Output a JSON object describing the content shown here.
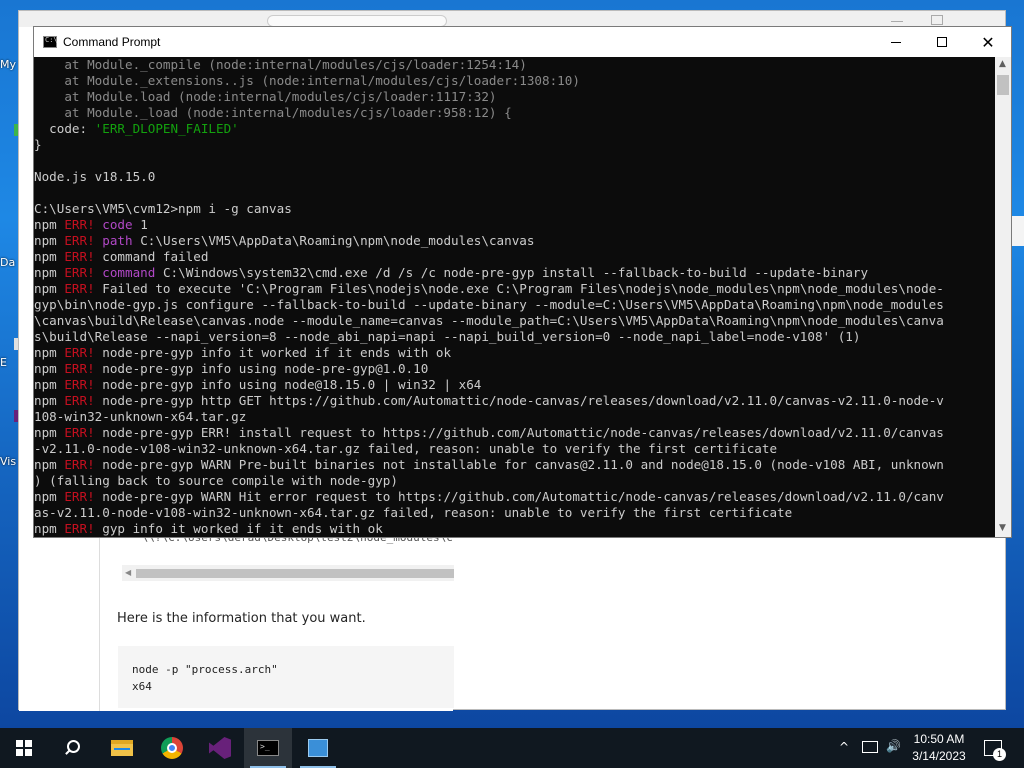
{
  "desktop": {
    "icon_labels": [
      "My",
      "Da",
      "E",
      "Vis"
    ]
  },
  "browser": {
    "path_fragment": "\"\\\\?\\C:\\Users\\derad\\Desktop\\test2\\node_modules\\c",
    "info_text": "Here is the information that you want.",
    "code_lines": [
      "node -p \"process.arch\"",
      "x64"
    ]
  },
  "cmd_window": {
    "title": "Command Prompt",
    "icon": "C:\\",
    "buttons": {
      "minimize": "minimize-icon",
      "maximize": "maximize-icon",
      "close": "close-icon"
    },
    "close_glyph": "✕",
    "lines": [
      [
        {
          "t": "    at Module._compile (node:internal/modules/cjs/loader:1254:14)",
          "c": "gray"
        }
      ],
      [
        {
          "t": "    at Module._extensions..js (node:internal/modules/cjs/loader:1308:10)",
          "c": "gray"
        }
      ],
      [
        {
          "t": "    at Module.load (node:internal/modules/cjs/loader:1117:32)",
          "c": "gray"
        }
      ],
      [
        {
          "t": "    at Module._load (node:internal/modules/cjs/loader:958:12) {",
          "c": "gray"
        },
        {
          "t": "",
          "c": "white"
        }
      ],
      [
        {
          "t": "  code: ",
          "c": "white"
        },
        {
          "t": "'ERR_DLOPEN_FAILED'",
          "c": "green"
        }
      ],
      [
        {
          "t": "}",
          "c": "white"
        }
      ],
      [
        {
          "t": "",
          "c": "white"
        }
      ],
      [
        {
          "t": "Node.js v18.15.0",
          "c": "white"
        }
      ],
      [
        {
          "t": "",
          "c": "white"
        }
      ],
      [
        {
          "t": "C:\\Users\\VM5\\cvm12>npm i -g canvas",
          "c": "white"
        }
      ],
      [
        {
          "t": "npm ",
          "c": "white"
        },
        {
          "t": "ERR!",
          "c": "red"
        },
        {
          "t": " code",
          "c": "mag"
        },
        {
          "t": " 1",
          "c": "white"
        }
      ],
      [
        {
          "t": "npm ",
          "c": "white"
        },
        {
          "t": "ERR!",
          "c": "red"
        },
        {
          "t": " path",
          "c": "mag"
        },
        {
          "t": " C:\\Users\\VM5\\AppData\\Roaming\\npm\\node_modules\\canvas",
          "c": "white"
        }
      ],
      [
        {
          "t": "npm ",
          "c": "white"
        },
        {
          "t": "ERR!",
          "c": "red"
        },
        {
          "t": " command failed",
          "c": "white"
        }
      ],
      [
        {
          "t": "npm ",
          "c": "white"
        },
        {
          "t": "ERR!",
          "c": "red"
        },
        {
          "t": " command",
          "c": "mag"
        },
        {
          "t": " C:\\Windows\\system32\\cmd.exe /d /s /c node-pre-gyp install --fallback-to-build --update-binary",
          "c": "white"
        }
      ],
      [
        {
          "t": "npm ",
          "c": "white"
        },
        {
          "t": "ERR!",
          "c": "red"
        },
        {
          "t": " Failed to execute 'C:\\Program Files\\nodejs\\node.exe C:\\Program Files\\nodejs\\node_modules\\npm\\node_modules\\node-",
          "c": "white"
        }
      ],
      [
        {
          "t": "gyp\\bin\\node-gyp.js configure --fallback-to-build --update-binary --module=C:\\Users\\VM5\\AppData\\Roaming\\npm\\node_modules",
          "c": "white"
        }
      ],
      [
        {
          "t": "\\canvas\\build\\Release\\canvas.node --module_name=canvas --module_path=C:\\Users\\VM5\\AppData\\Roaming\\npm\\node_modules\\canva",
          "c": "white"
        }
      ],
      [
        {
          "t": "s\\build\\Release --napi_version=8 --node_abi_napi=napi --napi_build_version=0 --node_napi_label=node-v108' (1)",
          "c": "white"
        }
      ],
      [
        {
          "t": "npm ",
          "c": "white"
        },
        {
          "t": "ERR!",
          "c": "red"
        },
        {
          "t": " node-pre-gyp info it worked if it ends with ok",
          "c": "white"
        }
      ],
      [
        {
          "t": "npm ",
          "c": "white"
        },
        {
          "t": "ERR!",
          "c": "red"
        },
        {
          "t": " node-pre-gyp info using node-pre-gyp@1.0.10",
          "c": "white"
        }
      ],
      [
        {
          "t": "npm ",
          "c": "white"
        },
        {
          "t": "ERR!",
          "c": "red"
        },
        {
          "t": " node-pre-gyp info using node@18.15.0 | win32 | x64",
          "c": "white"
        }
      ],
      [
        {
          "t": "npm ",
          "c": "white"
        },
        {
          "t": "ERR!",
          "c": "red"
        },
        {
          "t": " node-pre-gyp http GET https://github.com/Automattic/node-canvas/releases/download/v2.11.0/canvas-v2.11.0-node-v",
          "c": "white"
        }
      ],
      [
        {
          "t": "108-win32-unknown-x64.tar.gz",
          "c": "white"
        }
      ],
      [
        {
          "t": "npm ",
          "c": "white"
        },
        {
          "t": "ERR!",
          "c": "red"
        },
        {
          "t": " node-pre-gyp ERR! install request to https://github.com/Automattic/node-canvas/releases/download/v2.11.0/canvas",
          "c": "white"
        }
      ],
      [
        {
          "t": "-v2.11.0-node-v108-win32-unknown-x64.tar.gz failed, reason: unable to verify the first certificate",
          "c": "white"
        }
      ],
      [
        {
          "t": "npm ",
          "c": "white"
        },
        {
          "t": "ERR!",
          "c": "red"
        },
        {
          "t": " node-pre-gyp WARN Pre-built binaries not installable for canvas@2.11.0 and node@18.15.0 (node-v108 ABI, unknown",
          "c": "white"
        }
      ],
      [
        {
          "t": ") (falling back to source compile with node-gyp)",
          "c": "white"
        }
      ],
      [
        {
          "t": "npm ",
          "c": "white"
        },
        {
          "t": "ERR!",
          "c": "red"
        },
        {
          "t": " node-pre-gyp WARN Hit error request to https://github.com/Automattic/node-canvas/releases/download/v2.11.0/canv",
          "c": "white"
        }
      ],
      [
        {
          "t": "as-v2.11.0-node-v108-win32-unknown-x64.tar.gz failed, reason: unable to verify the first certificate",
          "c": "white"
        }
      ],
      [
        {
          "t": "npm ",
          "c": "white"
        },
        {
          "t": "ERR!",
          "c": "red"
        },
        {
          "t": " gyp info it worked if it ends with ok",
          "c": "white"
        }
      ]
    ]
  },
  "taskbar": {
    "items": [
      "start-icon",
      "search-icon",
      "file-explorer-icon",
      "chrome-icon",
      "visual-studio-icon",
      "command-prompt-icon",
      "control-panel-icon"
    ],
    "tray": {
      "chevron": "^",
      "volume": "🔊"
    },
    "time": "10:50 AM",
    "date": "3/14/2023",
    "notification_count": "1"
  },
  "colors": {
    "console_bg": "#0c0c0c",
    "console_text": "#cccccc",
    "err_red": "#c50f1f",
    "keyword_magenta": "#b148c6",
    "string_green": "#13a10e"
  }
}
